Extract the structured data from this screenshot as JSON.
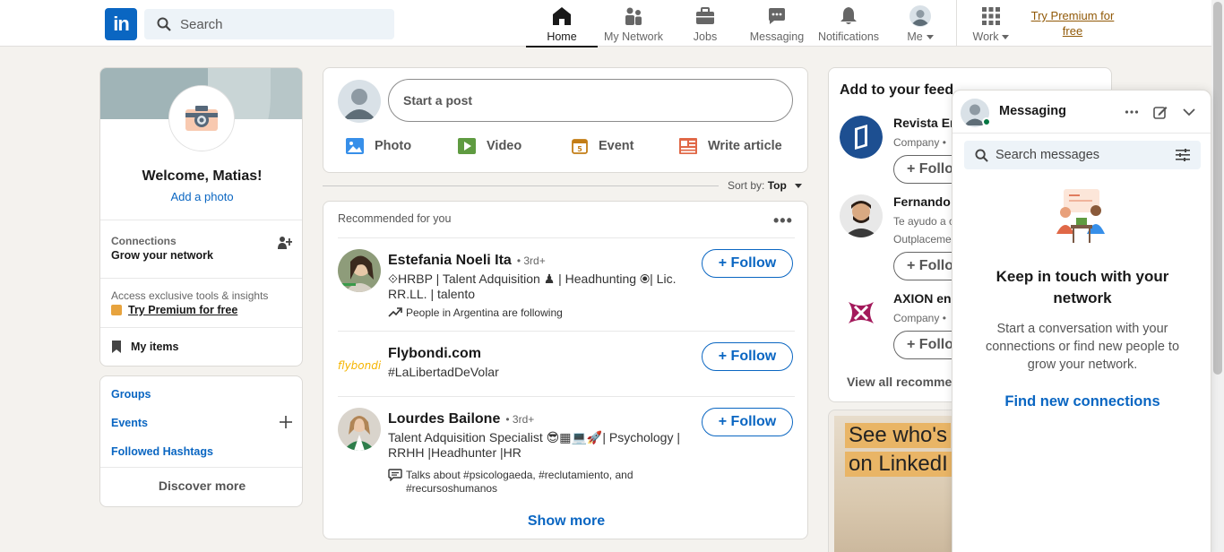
{
  "nav": {
    "logo_text": "in",
    "search_placeholder": "Search",
    "items": [
      {
        "label": "Home",
        "icon": "home-icon"
      },
      {
        "label": "My Network",
        "icon": "network-icon"
      },
      {
        "label": "Jobs",
        "icon": "briefcase-icon"
      },
      {
        "label": "Messaging",
        "icon": "chat-icon"
      },
      {
        "label": "Notifications",
        "icon": "bell-icon"
      },
      {
        "label": "Me",
        "icon": "avatar"
      },
      {
        "label": "Work",
        "icon": "grid-icon"
      }
    ],
    "premium_line1": "Try Premium for",
    "premium_line2": "free"
  },
  "profile": {
    "welcome": "Welcome, Matias!",
    "add_photo": "Add a photo",
    "connections_title": "Connections",
    "connections_sub": "Grow your network",
    "access_text": "Access exclusive tools & insights",
    "try_premium": "Try Premium for free",
    "my_items": "My items"
  },
  "side_links": {
    "groups": "Groups",
    "events": "Events",
    "hashtags": "Followed Hashtags",
    "discover": "Discover more"
  },
  "post_box": {
    "placeholder": "Start a post",
    "actions": [
      "Photo",
      "Video",
      "Event",
      "Write article"
    ]
  },
  "sort": {
    "label": "Sort by:",
    "value": "Top"
  },
  "recommendations": {
    "header": "Recommended for you",
    "follow_label": "+ Follow",
    "show_more": "Show more",
    "items": [
      {
        "name": "Estefania Noeli Ita",
        "degree": "• 3rd+",
        "desc": "⟐HRBP | Talent Adquisition ♟ | Headhunting ⦿| Lic. RR.LL. | talento",
        "meta": "People in Argentina are following"
      },
      {
        "name": "Flybondi.com",
        "degree": "",
        "desc": "#LaLibertadDeVolar",
        "meta": ""
      },
      {
        "name": "Lourdes Bailone",
        "degree": "• 3rd+",
        "desc": "Talent Adquisition Specialist 😎▦💻🚀| Psychology | RRHH |Headhunter |HR",
        "meta": "Talks about #psicologaeda, #reclutamiento, and #recursoshumanos"
      }
    ],
    "flybondi_logo": "flybondi"
  },
  "feed": {
    "title": "Add to your feed",
    "follow_label": "+ Follo",
    "items": [
      {
        "name": "Revista Er",
        "sub": "Company • "
      },
      {
        "name": "Fernando",
        "sub": "Te ayudo a c",
        "sub2": "Outplaceme"
      },
      {
        "name": "AXION en",
        "sub": "Company • "
      }
    ],
    "view_all": "View all recomme"
  },
  "ad": {
    "line1": "See who's",
    "line2": "on LinkedI"
  },
  "messaging": {
    "title": "Messaging",
    "search_placeholder": "Search messages",
    "heading": "Keep in touch with your network",
    "body": "Start a conversation with your connections or find new people to grow your network.",
    "link": "Find new connections"
  },
  "colors": {
    "brand_blue": "#0a66c2",
    "premium_gold": "#915907",
    "online_green": "#057642"
  }
}
